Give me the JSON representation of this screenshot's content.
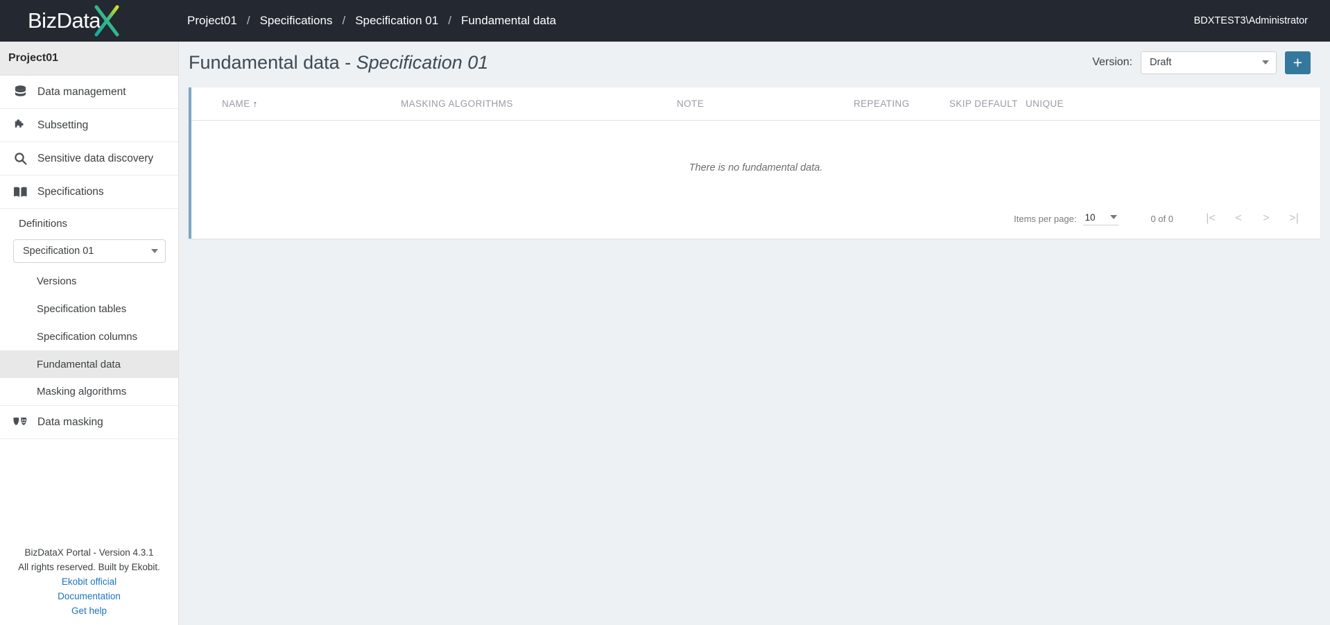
{
  "topbar": {
    "logo_text": "BizData",
    "logo_x": "X",
    "breadcrumb": [
      {
        "label": "Project01",
        "name": "breadcrumb-project01"
      },
      {
        "label": "Specifications",
        "name": "breadcrumb-specifications"
      },
      {
        "label": "Specification 01",
        "name": "breadcrumb-specification-01"
      },
      {
        "label": "Fundamental data",
        "name": "breadcrumb-fundamental-data"
      }
    ],
    "separator": "/",
    "user": "BDXTEST3\\Administrator",
    "bg_color": "#242830"
  },
  "sidebar": {
    "project_name": "Project01",
    "nav": [
      {
        "label": "Data management",
        "icon": "database-icon"
      },
      {
        "label": "Subsetting",
        "icon": "puzzle-icon"
      },
      {
        "label": "Sensitive data discovery",
        "icon": "search-icon"
      },
      {
        "label": "Specifications",
        "icon": "book-icon"
      }
    ],
    "definitions_label": "Definitions",
    "spec_select_value": "Specification 01",
    "sub_items": [
      {
        "label": "Versions",
        "active": false
      },
      {
        "label": "Specification tables",
        "active": false
      },
      {
        "label": "Specification columns",
        "active": false
      },
      {
        "label": "Fundamental data",
        "active": true
      },
      {
        "label": "Masking algorithms",
        "active": false
      }
    ],
    "data_masking": {
      "label": "Data masking",
      "icon": "masks-icon"
    },
    "footer": {
      "line1": "BizDataX Portal - Version 4.3.1",
      "line2": "All rights reserved. Built by Ekobit.",
      "link1": "Ekobit official",
      "link2": "Documentation",
      "link3": "Get help"
    }
  },
  "page": {
    "title_main": "Fundamental data - ",
    "title_em": "Specification 01",
    "version_label": "Version:",
    "version_value": "Draft",
    "add_button": "+",
    "accent_color": "#35789e",
    "card_accent": "#7ba7c4"
  },
  "table": {
    "columns": [
      {
        "label": "NAME",
        "sorted": true,
        "sort_dir": "↑"
      },
      {
        "label": "MASKING ALGORITHMS",
        "sorted": false
      },
      {
        "label": "NOTE",
        "sorted": false
      },
      {
        "label": "REPEATING",
        "sorted": false
      },
      {
        "label": "SKIP DEFAULT",
        "sorted": false
      },
      {
        "label": "UNIQUE",
        "sorted": false
      }
    ],
    "rows": [],
    "empty_message": "There is no fundamental data."
  },
  "paginator": {
    "items_per_page_label": "Items per page:",
    "items_per_page_value": "10",
    "range_label": "0 of 0",
    "first_icon": "|<",
    "prev_icon": "<",
    "next_icon": ">",
    "last_icon": ">|"
  }
}
